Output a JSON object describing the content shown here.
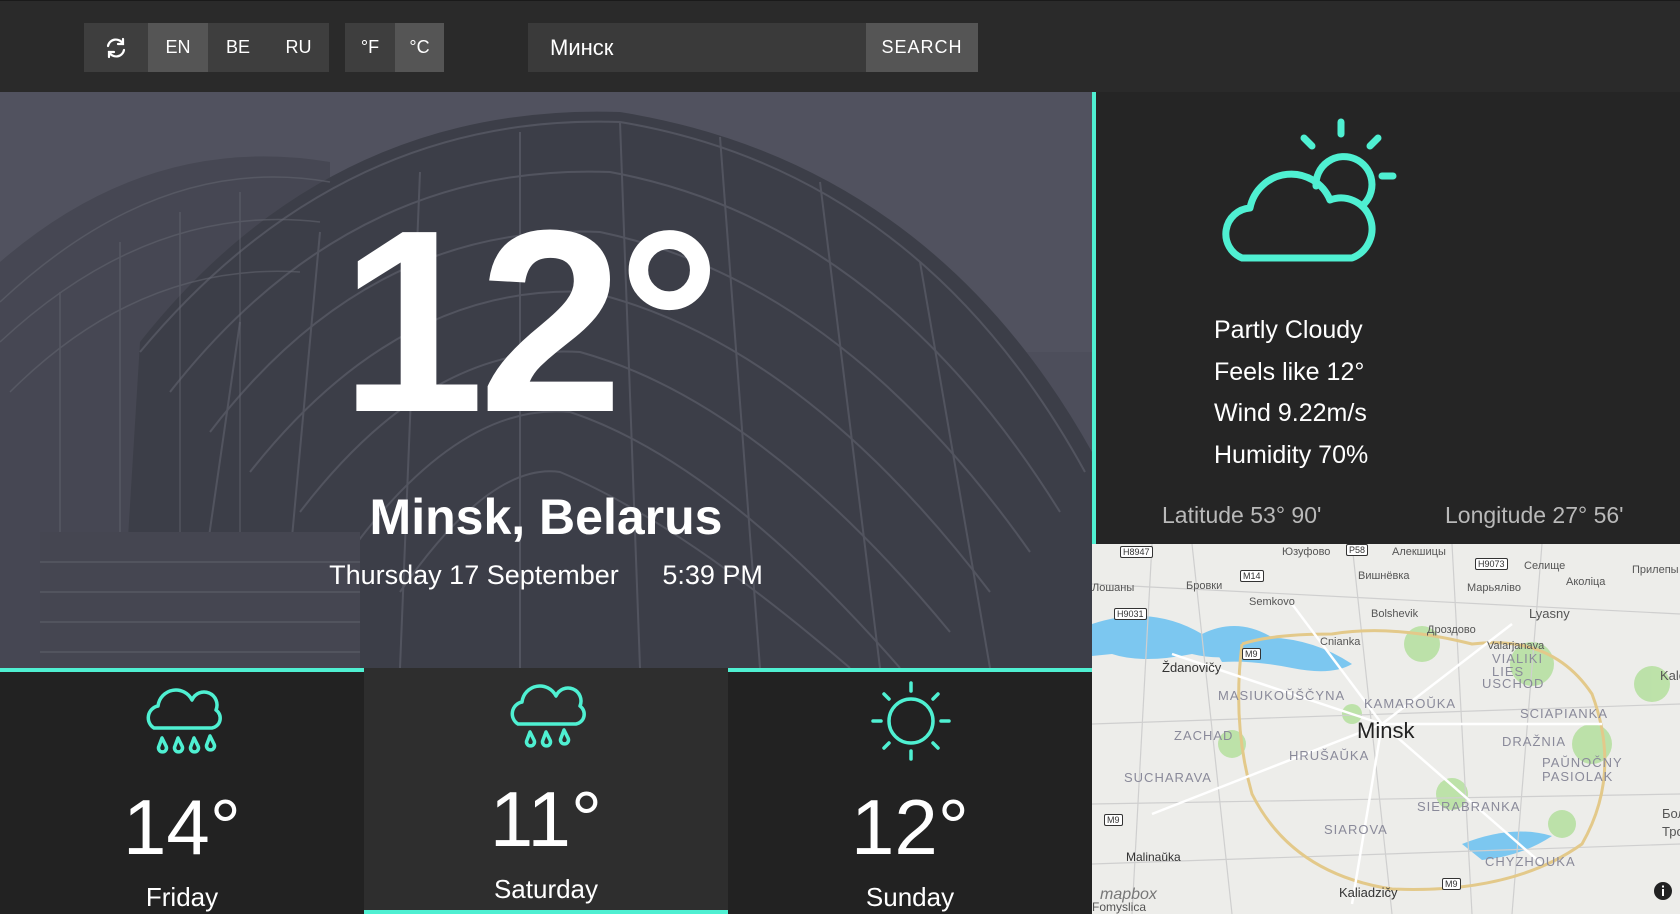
{
  "toolbar": {
    "refresh_icon": "refresh-icon",
    "languages": [
      "EN",
      "BE",
      "RU"
    ],
    "active_language": "EN",
    "units": [
      "°F",
      "°C"
    ],
    "active_unit": "°C",
    "search_value": "Минск",
    "mic_icon": "microphone-icon",
    "search_label": "SEARCH"
  },
  "current": {
    "temperature": "12°",
    "location": "Minsk, Belarus",
    "date": "Thursday 17 September",
    "time": "5:39 PM"
  },
  "details": {
    "icon": "partly-cloudy-icon",
    "condition": "Partly Cloudy",
    "feels_like": "Feels like 12°",
    "wind": "Wind 9.22m/s",
    "humidity": "Humidity 70%",
    "latitude": "Latitude 53° 90'",
    "longitude": "Longitude 27° 56'"
  },
  "map": {
    "city": "Minsk",
    "logo": "mapbox",
    "labels": [
      "Юзуфово",
      "Алекшицы",
      "Вишнёвка",
      "Селище",
      "Аколіца",
      "Прилепы",
      "Лошаны",
      "Бровки",
      "Марьялiвo",
      "Semkovo",
      "Bolshevik",
      "Lyasny",
      "Дроздово",
      "Cnianka",
      "Valarjanava",
      "Ždanovičy",
      "Malinaŭka",
      "Kaliadzičy",
      "Kalo",
      "Бол",
      "Тро",
      "Fomyslica"
    ],
    "districts": [
      "VIALIKI LIES",
      "USCHOD",
      "MASIUKOŬŠČYNA",
      "KAMAROŬKA",
      "SCIAPIANKA",
      "ZACHAD",
      "HRUŠAŬKA",
      "DRAŽNIA",
      "SUCHARAVA",
      "PAŬNOČNY PASIOLAK",
      "SIERABRANKA",
      "SIAROVA",
      "CHYZHOUKA"
    ],
    "roads": [
      "H8947",
      "P58",
      "H9073",
      "M14",
      "H9031",
      "M9",
      "M9",
      "M9"
    ]
  },
  "forecast": [
    {
      "day": "Friday",
      "temp": "14°",
      "icon": "rain-cloud-icon"
    },
    {
      "day": "Saturday",
      "temp": "11°",
      "icon": "rain-cloud-icon"
    },
    {
      "day": "Sunday",
      "temp": "12°",
      "icon": "sun-icon"
    }
  ],
  "colors": {
    "accent": "#4ff0d2",
    "topbar": "#2a2a2a",
    "panel": "#252525"
  }
}
